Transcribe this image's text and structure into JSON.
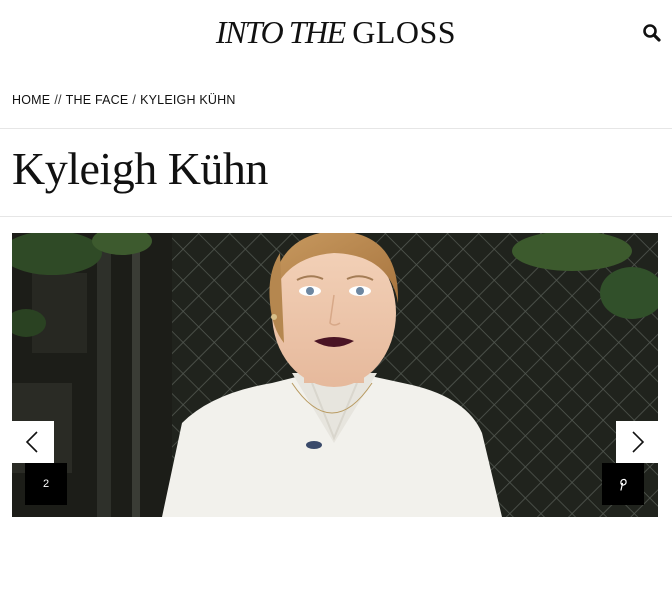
{
  "header": {
    "logo_italic": "INTO THE",
    "logo_regular": "GLOSS",
    "search_icon": "search-icon"
  },
  "breadcrumb": {
    "items": [
      {
        "label": "HOME"
      },
      {
        "label": "THE FACE"
      }
    ],
    "separators": [
      "//",
      "/"
    ],
    "current": "KYLEIGH KÜHN"
  },
  "article": {
    "title": "Kyleigh Kühn"
  },
  "slideshow": {
    "counter": "2",
    "prev_icon": "chevron-left-icon",
    "next_icon": "chevron-right-icon",
    "pin_icon": "pinterest-icon"
  }
}
